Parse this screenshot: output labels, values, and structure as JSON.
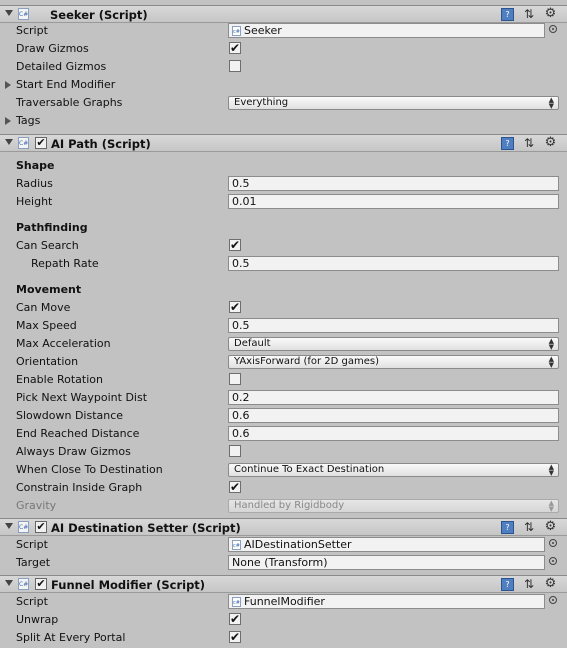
{
  "header_icons": {
    "help": "book-icon",
    "preset": "preset-icon",
    "settings": "gear-icon"
  },
  "seeker": {
    "title": "Seeker (Script)",
    "script_label": "Script",
    "script_value": "Seeker",
    "draw_gizmos_label": "Draw Gizmos",
    "draw_gizmos": true,
    "detailed_gizmos_label": "Detailed Gizmos",
    "detailed_gizmos": false,
    "start_end_label": "Start End Modifier",
    "traversable_label": "Traversable Graphs",
    "traversable_value": "Everything",
    "tags_label": "Tags"
  },
  "ai_path": {
    "title": "AI Path (Script)",
    "shape_heading": "Shape",
    "radius_label": "Radius",
    "radius": "0.5",
    "height_label": "Height",
    "height": "0.01",
    "pathfinding_heading": "Pathfinding",
    "can_search_label": "Can Search",
    "can_search": true,
    "repath_label": "Repath Rate",
    "repath_rate": "0.5",
    "movement_heading": "Movement",
    "can_move_label": "Can Move",
    "can_move": true,
    "max_speed_label": "Max Speed",
    "max_speed": "0.5",
    "max_accel_label": "Max Acceleration",
    "max_accel": "Default",
    "orientation_label": "Orientation",
    "orientation": "YAxisForward (for 2D games)",
    "enable_rotation_label": "Enable Rotation",
    "enable_rotation": false,
    "pick_next_label": "Pick Next Waypoint Dist",
    "pick_next": "0.2",
    "slowdown_label": "Slowdown Distance",
    "slowdown": "0.6",
    "end_reached_label": "End Reached Distance",
    "end_reached": "0.6",
    "always_draw_label": "Always Draw Gizmos",
    "always_draw": false,
    "when_close_label": "When Close To Destination",
    "when_close": "Continue To Exact Destination",
    "constrain_label": "Constrain Inside Graph",
    "constrain": true,
    "gravity_label": "Gravity",
    "gravity": "Handled by Rigidbody"
  },
  "destination_setter": {
    "title": "AI Destination Setter (Script)",
    "script_label": "Script",
    "script_value": "AIDestinationSetter",
    "target_label": "Target",
    "target_value": "None (Transform)"
  },
  "funnel": {
    "title": "Funnel Modifier (Script)",
    "script_label": "Script",
    "script_value": "FunnelModifier",
    "unwrap_label": "Unwrap",
    "unwrap": true,
    "split_label": "Split At Every Portal",
    "split": true
  }
}
